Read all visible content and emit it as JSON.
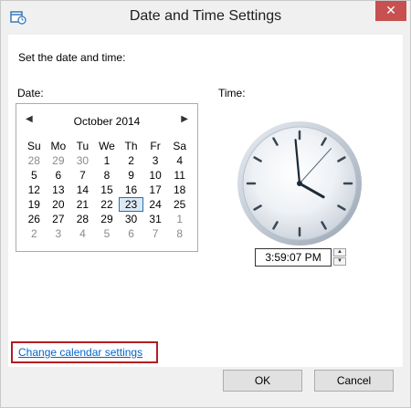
{
  "window": {
    "title": "Date and Time Settings",
    "close_glyph": "✕"
  },
  "content": {
    "instruction": "Set the date and time:",
    "date_label": "Date:",
    "time_label": "Time:"
  },
  "calendar": {
    "month": "October 2014",
    "prev_glyph": "◀",
    "next_glyph": "▶",
    "weekdays": [
      "Su",
      "Mo",
      "Tu",
      "We",
      "Th",
      "Fr",
      "Sa"
    ],
    "weeks": [
      [
        "28",
        "29",
        "30",
        "1",
        "2",
        "3",
        "4"
      ],
      [
        "5",
        "6",
        "7",
        "8",
        "9",
        "10",
        "11"
      ],
      [
        "12",
        "13",
        "14",
        "15",
        "16",
        "17",
        "18"
      ],
      [
        "19",
        "20",
        "21",
        "22",
        "23",
        "24",
        "25"
      ],
      [
        "26",
        "27",
        "28",
        "29",
        "30",
        "31",
        "1"
      ],
      [
        "2",
        "3",
        "4",
        "5",
        "6",
        "7",
        "8"
      ]
    ],
    "selected": "23"
  },
  "clock": {
    "hours": 3,
    "minutes": 59,
    "seconds": 7
  },
  "time": {
    "value": "3:59:07 PM",
    "up_glyph": "▲",
    "down_glyph": "▼"
  },
  "link": {
    "label": "Change calendar settings"
  },
  "buttons": {
    "ok": "OK",
    "cancel": "Cancel"
  }
}
